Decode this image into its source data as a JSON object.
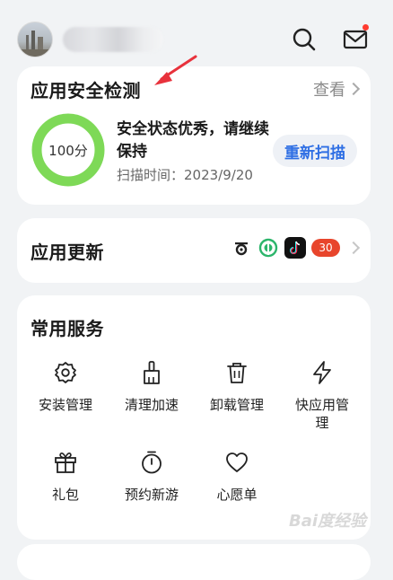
{
  "header": {
    "avatar_icon": "avatar-photo",
    "search_icon": "search-icon",
    "mail_icon": "mail-icon",
    "mail_has_notification": true
  },
  "security": {
    "title": "应用安全检测",
    "view_label": "查看",
    "score_label": "100分",
    "score_value": 100,
    "status_text": "安全状态优秀，请继续保持",
    "scan_time": "扫描时间：2023/9/20",
    "rescan_label": "重新扫描",
    "ring_color": "#7ed957"
  },
  "updates": {
    "title": "应用更新",
    "count": "30",
    "app_icons": [
      "app-icon-1",
      "app-icon-2",
      "tiktok-icon"
    ]
  },
  "services": {
    "title": "常用服务",
    "items": [
      {
        "label": "安装管理",
        "icon": "gear-icon"
      },
      {
        "label": "清理加速",
        "icon": "broom-icon"
      },
      {
        "label": "卸载管理",
        "icon": "trash-icon"
      },
      {
        "label": "快应用管理",
        "icon": "bolt-icon"
      },
      {
        "label": "礼包",
        "icon": "gift-icon"
      },
      {
        "label": "预约新游",
        "icon": "stopwatch-icon"
      },
      {
        "label": "心愿单",
        "icon": "heart-icon"
      }
    ]
  },
  "watermark": "Bai度经验",
  "colors": {
    "accent": "#2f6fe4",
    "badge": "#e8452c",
    "background": "#f1f3f5",
    "annotation_arrow": "#e8323c"
  }
}
